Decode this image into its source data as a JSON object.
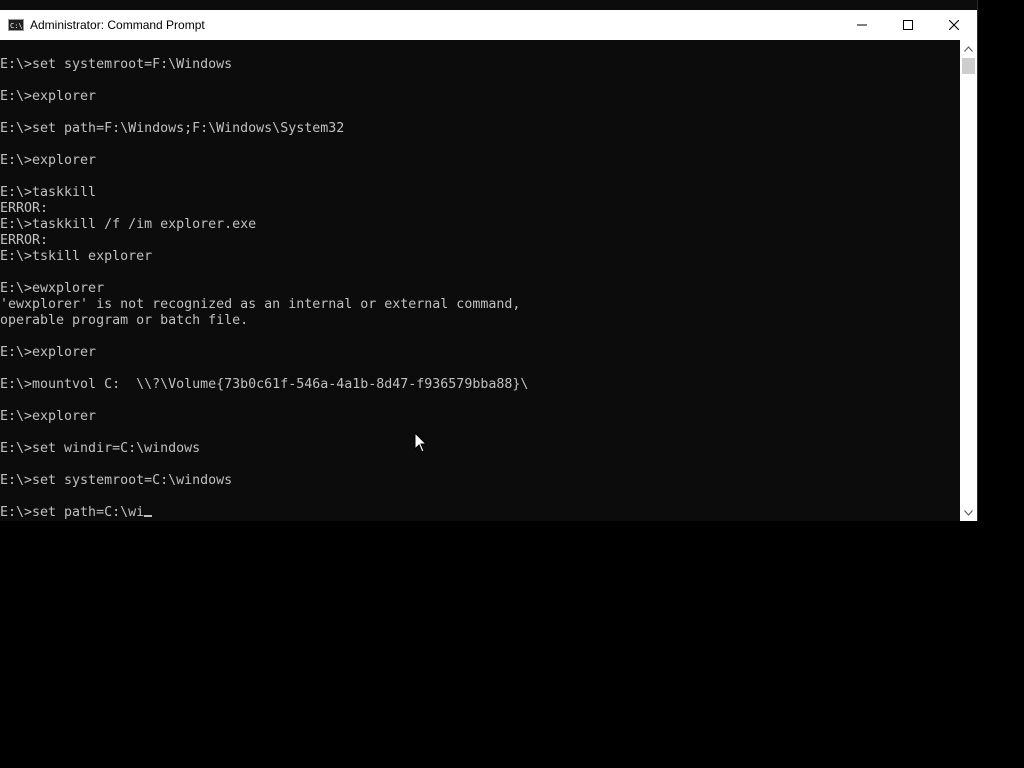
{
  "window": {
    "title": "Administrator: Command Prompt",
    "app_icon_text": "C:\\"
  },
  "controls": {
    "minimize_icon": "minimize-icon",
    "maximize_icon": "maximize-icon",
    "close_icon": "close-icon"
  },
  "console": {
    "lines": [
      "E:\\>set systemroot=F:\\Windows",
      "",
      "E:\\>explorer",
      "",
      "E:\\>set path=F:\\Windows;F:\\Windows\\System32",
      "",
      "E:\\>explorer",
      "",
      "E:\\>taskkill",
      "ERROR:",
      "E:\\>taskkill /f /im explorer.exe",
      "ERROR:",
      "E:\\>tskill explorer",
      "",
      "E:\\>ewxplorer",
      "'ewxplorer' is not recognized as an internal or external command,",
      "operable program or batch file.",
      "",
      "E:\\>explorer",
      "",
      "E:\\>mountvol C:  \\\\?\\Volume{73b0c61f-546a-4a1b-8d47-f936579bba88}\\",
      "",
      "E:\\>explorer",
      "",
      "E:\\>set windir=C:\\windows",
      "",
      "E:\\>set systemroot=C:\\windows",
      "",
      "E:\\>set path=C:\\wi"
    ]
  },
  "colors": {
    "console_background": "#0c0c0c",
    "console_text": "#c0c0c0",
    "titlebar_background": "#ffffff",
    "desktop_background": "#000000"
  }
}
